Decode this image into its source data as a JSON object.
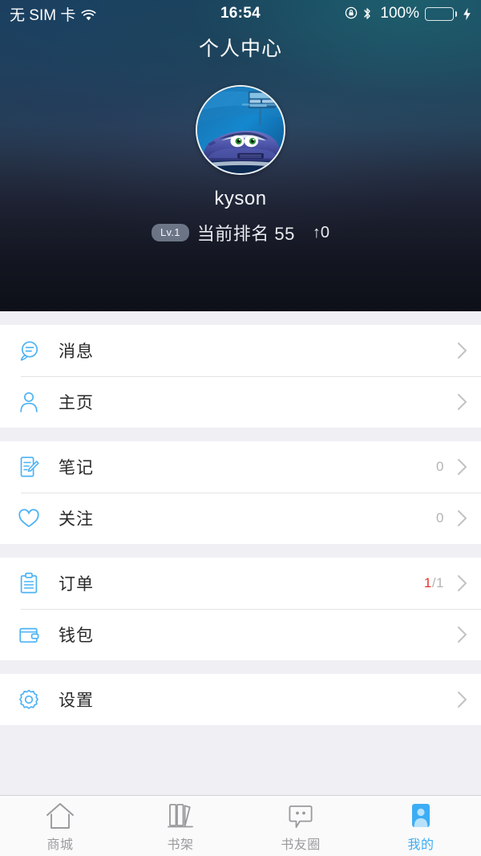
{
  "statusbar": {
    "carrier": "无 SIM 卡",
    "wifi_icon": "wifi-icon",
    "time": "16:54",
    "rotation_lock_icon": "rotation-lock-icon",
    "bluetooth_icon": "bluetooth-icon",
    "battery_percent": "100%",
    "battery_icon": "battery-full-icon",
    "charging_icon": "charging-bolt-icon",
    "battery_color": "#4cd964"
  },
  "nav": {
    "title": "个人中心"
  },
  "profile": {
    "avatar_icon": "avatar-image",
    "avatar_alt": "cartoon-car-avatar",
    "username": "kyson",
    "level_badge": "Lv.1",
    "rank_text": "当前排名 55",
    "rank_delta": "↑0"
  },
  "groups": [
    {
      "rows": [
        {
          "icon": "message-bubble-icon",
          "label": "消息",
          "value": "",
          "value_highlight": "",
          "chevron": "chevron-right-icon"
        },
        {
          "icon": "person-icon",
          "label": "主页",
          "value": "",
          "value_highlight": "",
          "chevron": "chevron-right-icon"
        }
      ]
    },
    {
      "rows": [
        {
          "icon": "note-edit-icon",
          "label": "笔记",
          "value": "0",
          "value_highlight": "",
          "chevron": "chevron-right-icon"
        },
        {
          "icon": "heart-icon",
          "label": "关注",
          "value": "0",
          "value_highlight": "",
          "chevron": "chevron-right-icon"
        }
      ]
    },
    {
      "rows": [
        {
          "icon": "clipboard-icon",
          "label": "订单",
          "value": "/1",
          "value_highlight": "1",
          "chevron": "chevron-right-icon"
        },
        {
          "icon": "wallet-icon",
          "label": "钱包",
          "value": "",
          "value_highlight": "",
          "chevron": "chevron-right-icon"
        }
      ]
    },
    {
      "rows": [
        {
          "icon": "gear-icon",
          "label": "设置",
          "value": "",
          "value_highlight": "",
          "chevron": "chevron-right-icon"
        }
      ]
    }
  ],
  "tabbar": {
    "items": [
      {
        "icon": "home-icon",
        "label": "商城",
        "active": false
      },
      {
        "icon": "bookshelf-icon",
        "label": "书架",
        "active": false
      },
      {
        "icon": "chat-bubble-icon",
        "label": "书友圈",
        "active": false
      },
      {
        "icon": "profile-person-icon",
        "label": "我的",
        "active": true
      }
    ],
    "active_color": "#3cadf5",
    "inactive_color": "#9a9a9e"
  },
  "colors": {
    "accent_blue": "#4cb3f5",
    "header_top_left": "#1e4463",
    "header_top_right": "#1d5566",
    "header_bottom": "#1c1f2c",
    "value_red": "#e8332a"
  }
}
